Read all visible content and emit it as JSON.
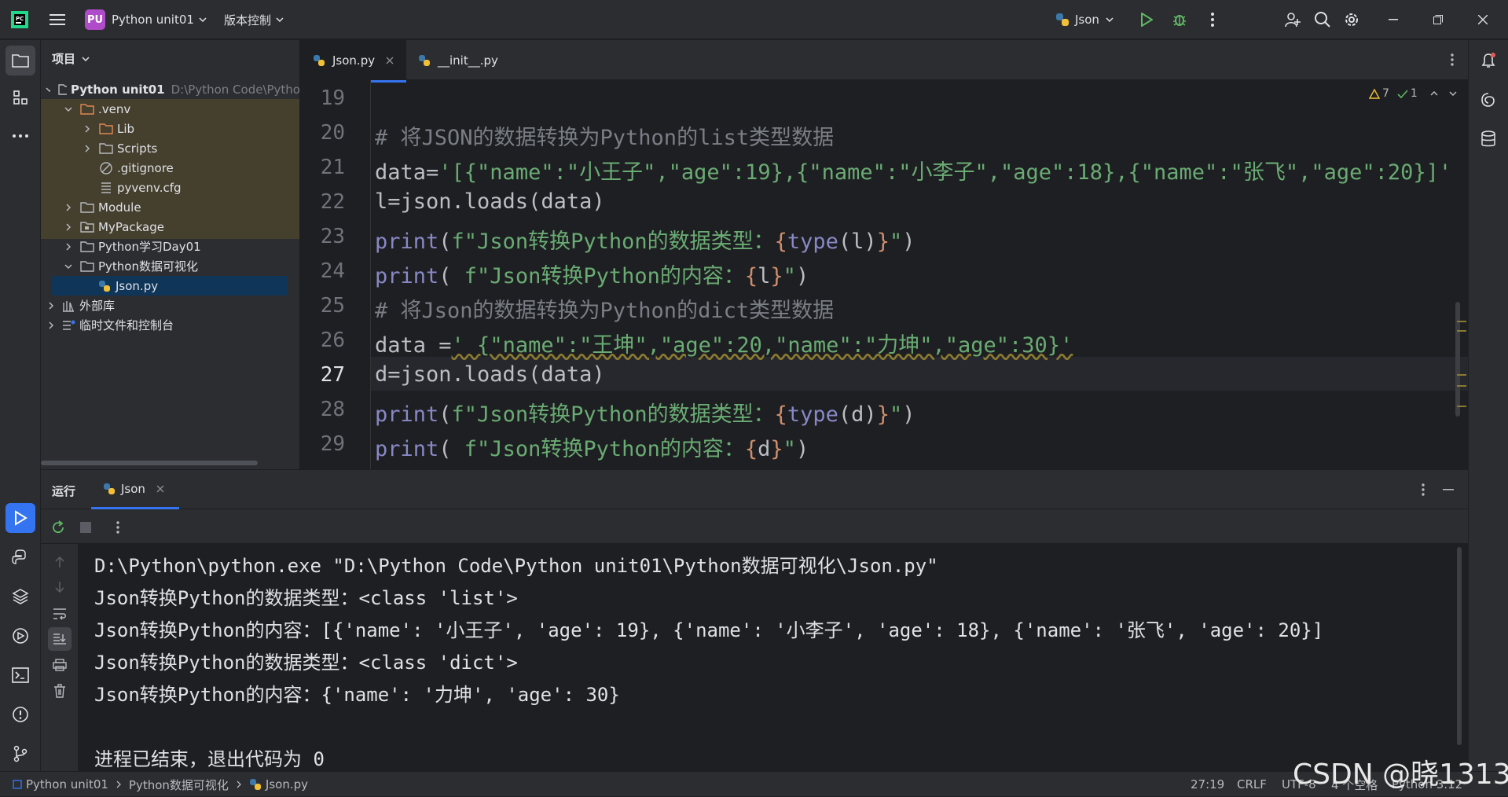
{
  "titlebar": {
    "project_badge": "PU",
    "project_name": "Python unit01",
    "vcs_label": "版本控制",
    "run_config": "Json"
  },
  "project_panel": {
    "title": "项目",
    "root_name": "Python unit01",
    "root_path": "D:\\Python Code\\Pytho",
    "items": [
      {
        "label": ".venv"
      },
      {
        "label": "Lib"
      },
      {
        "label": "Scripts"
      },
      {
        "label": ".gitignore"
      },
      {
        "label": "pyvenv.cfg"
      },
      {
        "label": "Module"
      },
      {
        "label": "MyPackage"
      },
      {
        "label": "Python学习Day01"
      },
      {
        "label": "Python数据可视化"
      },
      {
        "label": "Json.py"
      },
      {
        "label": "外部库"
      },
      {
        "label": "临时文件和控制台"
      }
    ]
  },
  "editor": {
    "tabs": [
      {
        "label": "Json.py",
        "active": true
      },
      {
        "label": "__init__.py",
        "active": false
      }
    ],
    "warnings": "7",
    "weak_warnings": "1",
    "line_numbers": [
      "19",
      "20",
      "21",
      "22",
      "23",
      "24",
      "25",
      "26",
      "27",
      "28",
      "29"
    ],
    "current_line": "27"
  },
  "code_lines": {
    "l20": "# 将JSON的数据转换为Python的list类型数据",
    "l21a": "data=",
    "l21b": "'[{\"name\":\"小王子\",\"age\":19},{\"name\":\"小李子\",\"age\":18},{\"name\":\"张飞\",\"age\":20}]'",
    "l22": "l=json.loads(data)",
    "l23a": "print",
    "l23b": "(",
    "l23c": "f\"Json转换Python的数据类型：",
    "l23d": "{",
    "l23e": "type",
    "l23f": "(l)",
    "l23g": "}",
    "l23h": "\"",
    "l23i": ")",
    "l24a": "print",
    "l24b": "( ",
    "l24c": "f\"Json转换Python的内容：",
    "l24d": "{",
    "l24e": "l",
    "l24f": "}",
    "l24g": "\"",
    "l24h": ")",
    "l25": "# 将Json的数据转换为Python的dict类型数据",
    "l26a": "data =",
    "l26b": "' {\"name\":\"王坤\",\"age\":20,\"name\":\"力坤\",\"age\":30}'",
    "l27": "d=json.loads(data)",
    "l28a": "print",
    "l28b": "(",
    "l28c": "f\"Json转换Python的数据类型：",
    "l28d": "{",
    "l28e": "type",
    "l28f": "(d)",
    "l28g": "}",
    "l28h": "\"",
    "l28i": ")",
    "l29a": "print",
    "l29b": "( ",
    "l29c": "f\"Json转换Python的内容：",
    "l29d": "{",
    "l29e": "d",
    "l29f": "}",
    "l29g": "\"",
    "l29h": ")"
  },
  "run_panel": {
    "title": "运行",
    "tab_label": "Json",
    "output": [
      "D:\\Python\\python.exe \"D:\\Python Code\\Python unit01\\Python数据可视化\\Json.py\"",
      "Json转换Python的数据类型：<class 'list'>",
      "Json转换Python的内容：[{'name': '小王子', 'age': 19}, {'name': '小李子', 'age': 18}, {'name': '张飞', 'age': 20}]",
      "Json转换Python的数据类型：<class 'dict'>",
      "Json转换Python的内容：{'name': '力坤', 'age': 30}",
      "",
      "进程已结束，退出代码为 0"
    ]
  },
  "statusbar": {
    "crumbs": [
      "Python unit01",
      "Python数据可视化",
      "Json.py"
    ],
    "position": "27:19",
    "line_sep": "CRLF",
    "encoding": "UTF-8",
    "indent": "4 个空格",
    "interpreter": "Python 3.12"
  },
  "watermark": "CSDN @晓1313",
  "colors": {
    "accent": "#3574f0",
    "bg_editor": "#1e1f22",
    "bg_panel": "#2b2d30",
    "keyword": "#56a8f5",
    "string": "#6aab73",
    "comment": "#7a7e85"
  }
}
